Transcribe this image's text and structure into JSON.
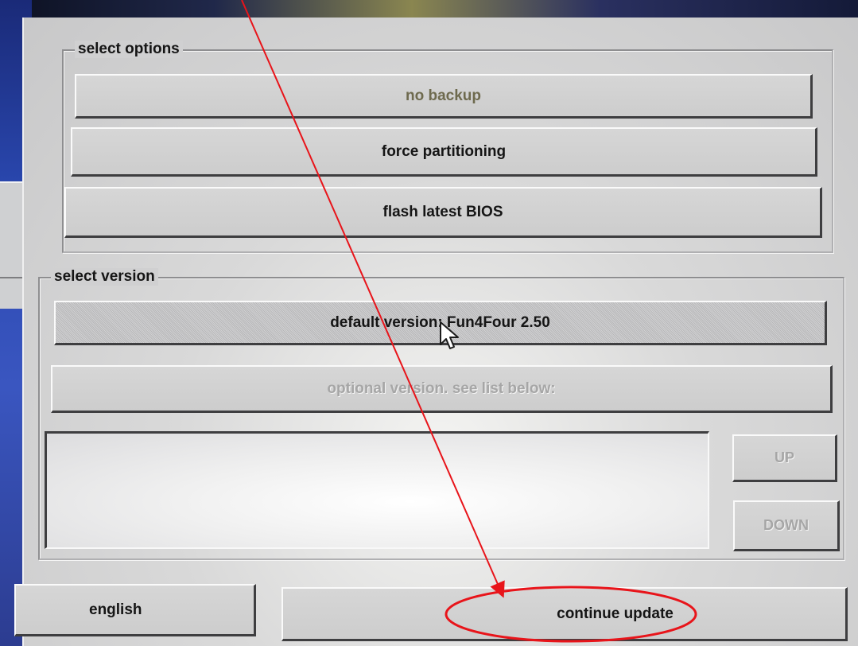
{
  "options_group": {
    "label": "select options",
    "buttons": {
      "no_backup": "no backup",
      "force_partitioning": "force partitioning",
      "flash_bios": "flash latest BIOS"
    }
  },
  "version_group": {
    "label": "select version",
    "default_version": "default version: Fun4Four 2.50",
    "optional_version": "optional version. see list below:",
    "list_items": [],
    "up_label": "UP",
    "down_label": "DOWN"
  },
  "footer": {
    "language_label": "english",
    "continue_label": "continue update"
  },
  "annotation": {
    "arrow_color": "#e8141a",
    "ellipse_color": "#e8141a"
  },
  "icons": {
    "cursor": "mouse-pointer-icon",
    "arrow": "red-annotation-arrow-icon",
    "ellipse": "red-highlight-ellipse-icon"
  }
}
